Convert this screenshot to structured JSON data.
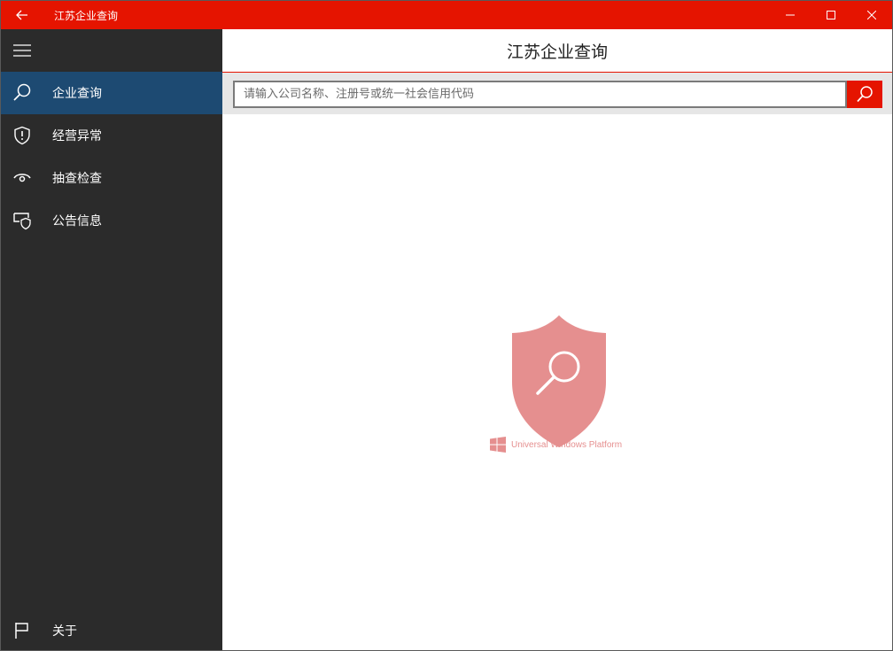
{
  "titlebar": {
    "title": "江苏企业查询",
    "back_icon": "back-arrow-icon",
    "controls": [
      "minimize-icon",
      "maximize-icon",
      "close-icon"
    ],
    "color": "#e51400"
  },
  "sidebar": {
    "background": "#2b2b2b",
    "active_color": "#1d4a72",
    "items": [
      {
        "label": "企业查询",
        "icon": "search-icon",
        "active": true
      },
      {
        "label": "经营异常",
        "icon": "shield-alert-icon",
        "active": false
      },
      {
        "label": "抽查检查",
        "icon": "eye-icon",
        "active": false
      },
      {
        "label": "公告信息",
        "icon": "announcement-shield-icon",
        "active": false
      }
    ],
    "bottom_item": {
      "label": "关于",
      "icon": "flag-icon"
    }
  },
  "main": {
    "header_title": "江苏企业查询",
    "search": {
      "placeholder": "请输入公司名称、注册号或统一社会信用代码",
      "value": ""
    },
    "logo_caption": "Universal Windows Platform"
  }
}
